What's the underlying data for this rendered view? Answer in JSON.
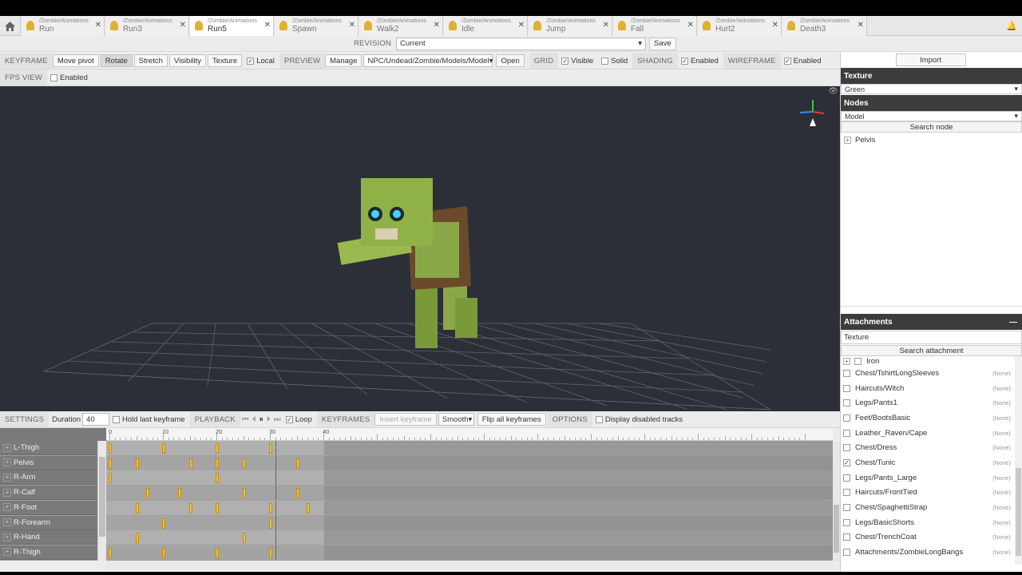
{
  "tabs": [
    {
      "path": "/Zombie/Animations",
      "name": "Run"
    },
    {
      "path": "/Zombie/Animations",
      "name": "Run3"
    },
    {
      "path": "/Zombie/Animations",
      "name": "Run5"
    },
    {
      "path": "/Zombie/Animations",
      "name": "Spawn"
    },
    {
      "path": "/Zombie/Animations",
      "name": "Walk2"
    },
    {
      "path": "/Zombie/Animations",
      "name": "Idle"
    },
    {
      "path": "/Zombie/Animations",
      "name": "Jump"
    },
    {
      "path": "/Zombie/Animations",
      "name": "Fall"
    },
    {
      "path": "/Zombie/Animations",
      "name": "Hurt2"
    },
    {
      "path": "/Zombie/Animations",
      "name": "Death3"
    }
  ],
  "revision": {
    "label": "REVISION",
    "value": "Current",
    "save": "Save"
  },
  "toolbar": {
    "keyframe": "KEYFRAME",
    "move_pivot": "Move pivot",
    "rotate": "Rotate",
    "stretch": "Stretch",
    "visibility": "Visibility",
    "texture": "Texture",
    "local": "Local",
    "preview": "PREVIEW",
    "manage": "Manage",
    "model_path": "NPC/Undead/Zombie/Models/Model",
    "open": "Open",
    "grid": "GRID",
    "visible": "Visible",
    "solid": "Solid",
    "shading": "SHADING",
    "shading_enabled": "Enabled",
    "wireframe": "WIREFRAME",
    "wireframe_enabled": "Enabled",
    "fps_view": "FPS VIEW",
    "fps_enabled": "Enabled"
  },
  "right": {
    "import": "Import",
    "texture_head": "Texture",
    "texture_value": "Green",
    "nodes_head": "Nodes",
    "nodes_value": "Model",
    "search_node": "Search node",
    "node_root": "Pelvis",
    "attachments_head": "Attachments",
    "attach_texture": "Texture",
    "search_attachment": "Search attachment",
    "iron": "Iron",
    "attachments": [
      {
        "name": "Chest/TshirtLongSleeves",
        "checked": false
      },
      {
        "name": "Haircuts/Witch",
        "checked": false
      },
      {
        "name": "Legs/Pants1",
        "checked": false
      },
      {
        "name": "Feet/BootsBasic",
        "checked": false
      },
      {
        "name": "Leather_Raven/Cape",
        "checked": false
      },
      {
        "name": "Chest/Dress",
        "checked": false
      },
      {
        "name": "Chest/Tunic",
        "checked": true
      },
      {
        "name": "Legs/Pants_Large",
        "checked": false
      },
      {
        "name": "Haircuts/FrontTied",
        "checked": false
      },
      {
        "name": "Chest/SpaghettiStrap",
        "checked": false
      },
      {
        "name": "Legs/BasicShorts",
        "checked": false
      },
      {
        "name": "Chest/TrenchCoat",
        "checked": false
      },
      {
        "name": "Attachments/ZombieLongBangs",
        "checked": false
      }
    ],
    "none": "(None)"
  },
  "timeline": {
    "settings": "SETTINGS",
    "duration_label": "Duration",
    "duration": "40",
    "hold_last": "Hold last keyframe",
    "playback": "PLAYBACK",
    "loop": "Loop",
    "keyframes": "KEYFRAMES",
    "insert": "Insert keyframe",
    "interp": "Smooth",
    "flip": "Flip all keyframes",
    "options": "OPTIONS",
    "display_disabled": "Display disabled tracks",
    "ruler": [
      "0",
      "10",
      "20",
      "30",
      "40"
    ],
    "tracks": [
      {
        "name": "L-Thigh",
        "keys": [
          0,
          10,
          20,
          30
        ]
      },
      {
        "name": "Pelvis",
        "keys": [
          0,
          5,
          15,
          20,
          25,
          35
        ]
      },
      {
        "name": "R-Arm",
        "keys": [
          0,
          20
        ]
      },
      {
        "name": "R-Calf",
        "keys": [
          7,
          13,
          25,
          35
        ]
      },
      {
        "name": "R-Foot",
        "keys": [
          5,
          15,
          20,
          30,
          37
        ]
      },
      {
        "name": "R-Forearm",
        "keys": [
          10,
          30
        ]
      },
      {
        "name": "R-Hand",
        "keys": [
          5,
          25
        ]
      },
      {
        "name": "R-Thigh",
        "keys": [
          0,
          10,
          20,
          30
        ]
      }
    ]
  }
}
